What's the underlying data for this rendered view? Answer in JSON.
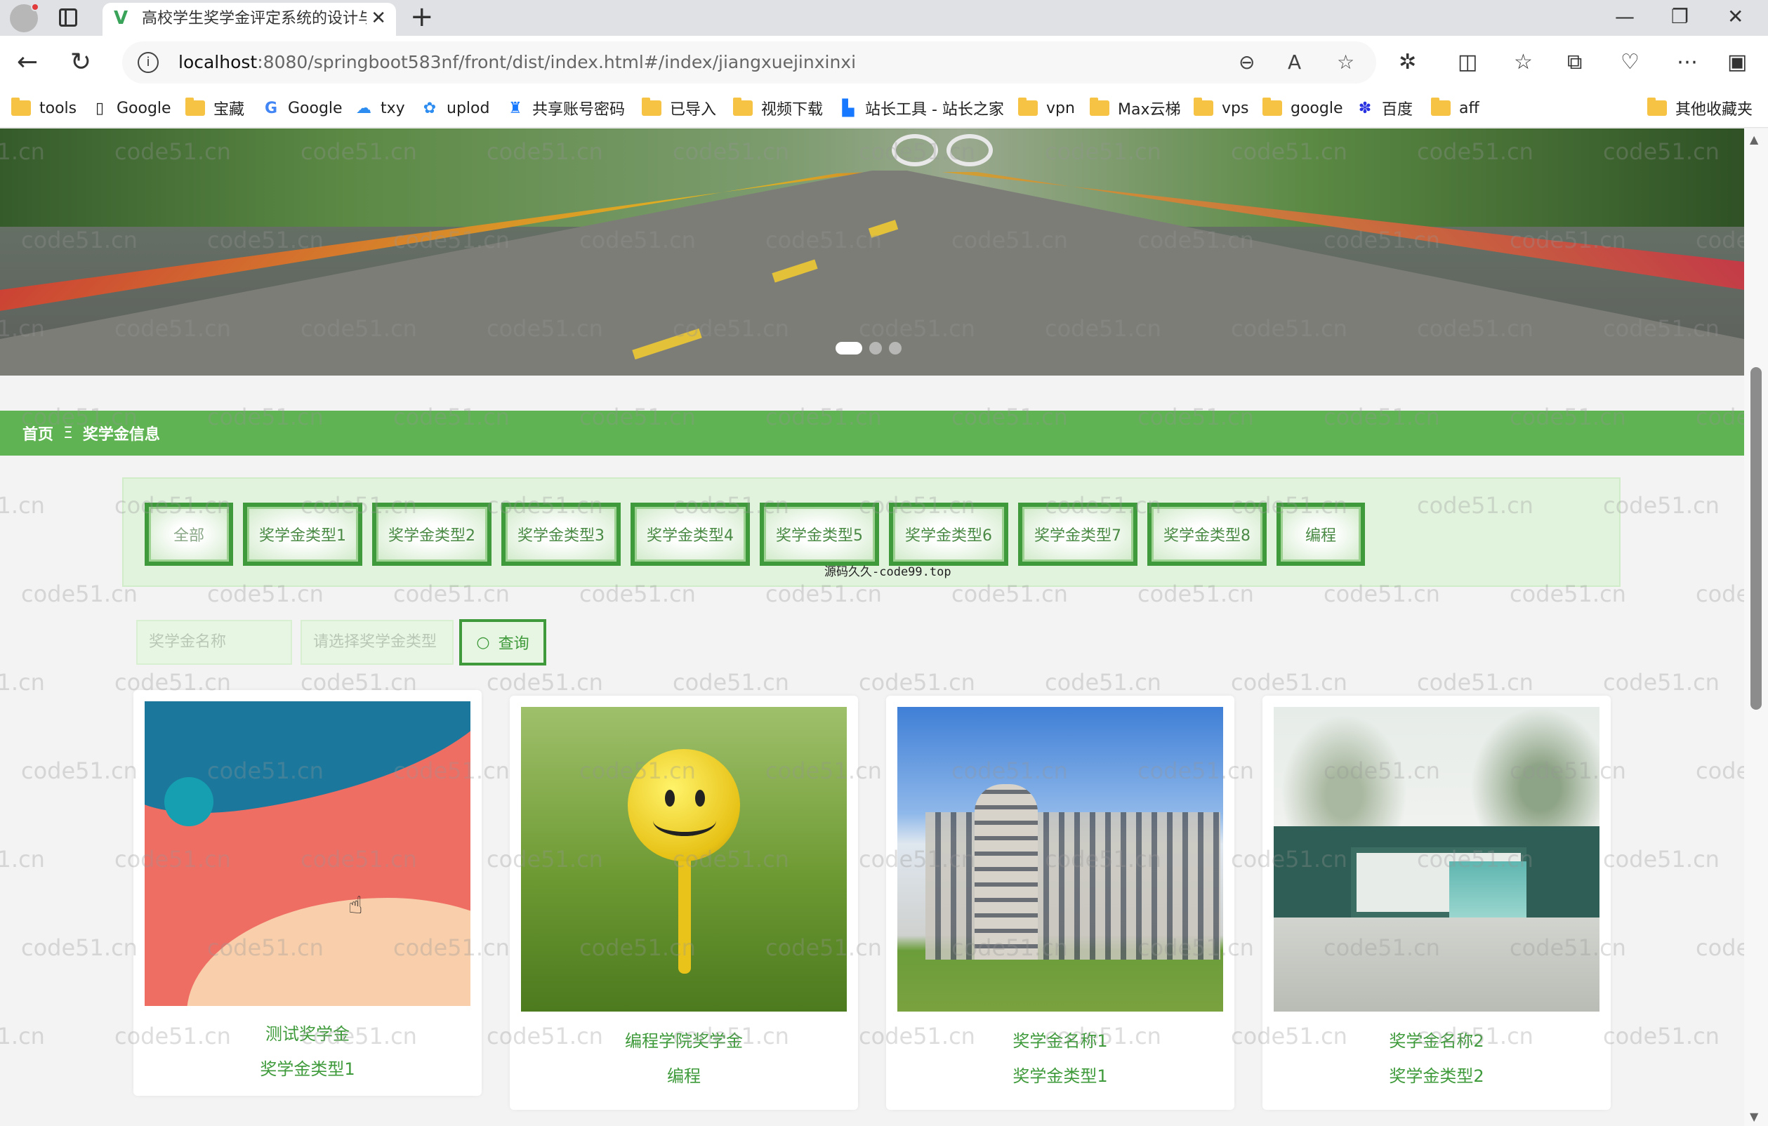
{
  "browser": {
    "tab_title": "高校学生奖学金评定系统的设计与",
    "url_host": "localhost",
    "url_rest": ":8080/springboot583nf/front/dist/index.html#/index/jiangxuejinxinxi",
    "bookmarks": [
      {
        "label": "tools",
        "icon": "folder-icon"
      },
      {
        "label": "Google",
        "icon": "page-icon"
      },
      {
        "label": "宝藏",
        "icon": "folder-icon"
      },
      {
        "label": "Google",
        "icon": "google-icon"
      },
      {
        "label": "txy",
        "icon": "cloud-icon"
      },
      {
        "label": "uplod",
        "icon": "upload-icon"
      },
      {
        "label": "共享账号密码",
        "icon": "share-icon"
      },
      {
        "label": "已导入",
        "icon": "folder-icon"
      },
      {
        "label": "视频下载",
        "icon": "folder-icon"
      },
      {
        "label": "站长工具 - 站长之家",
        "icon": "site-icon"
      },
      {
        "label": "vpn",
        "icon": "folder-icon"
      },
      {
        "label": "Max云梯",
        "icon": "folder-icon"
      },
      {
        "label": "vps",
        "icon": "folder-icon"
      },
      {
        "label": "google",
        "icon": "folder-icon"
      },
      {
        "label": "百度",
        "icon": "baidu-icon"
      },
      {
        "label": "aff",
        "icon": "folder-icon"
      }
    ],
    "other_bookmarks": "其他收藏夹"
  },
  "watermark": "code51.cn",
  "breadcrumb": {
    "home": "首页",
    "separator": "Ξ",
    "current": "奖学金信息"
  },
  "categories": [
    "全部",
    "奖学金类型1",
    "奖学金类型2",
    "奖学金类型3",
    "奖学金类型4",
    "奖学金类型5",
    "奖学金类型6",
    "奖学金类型7",
    "奖学金类型8",
    "编程"
  ],
  "source_tip": "源码久久-code99.top",
  "search": {
    "name_placeholder": "奖学金名称",
    "type_placeholder": "请选择奖学金类型",
    "button_label": "查询"
  },
  "cards": [
    {
      "name": "测试奖学金",
      "type": "奖学金类型1",
      "image": "abstract"
    },
    {
      "name": "编程学院奖学金",
      "type": "编程",
      "image": "golf-ball"
    },
    {
      "name": "奖学金名称1",
      "type": "奖学金类型1",
      "image": "building"
    },
    {
      "name": "奖学金名称2",
      "type": "奖学金类型2",
      "image": "gate"
    }
  ],
  "colors": {
    "accent_green": "#5fb352",
    "border_green": "#3e9a3a",
    "text_green": "#3e9a3a"
  }
}
